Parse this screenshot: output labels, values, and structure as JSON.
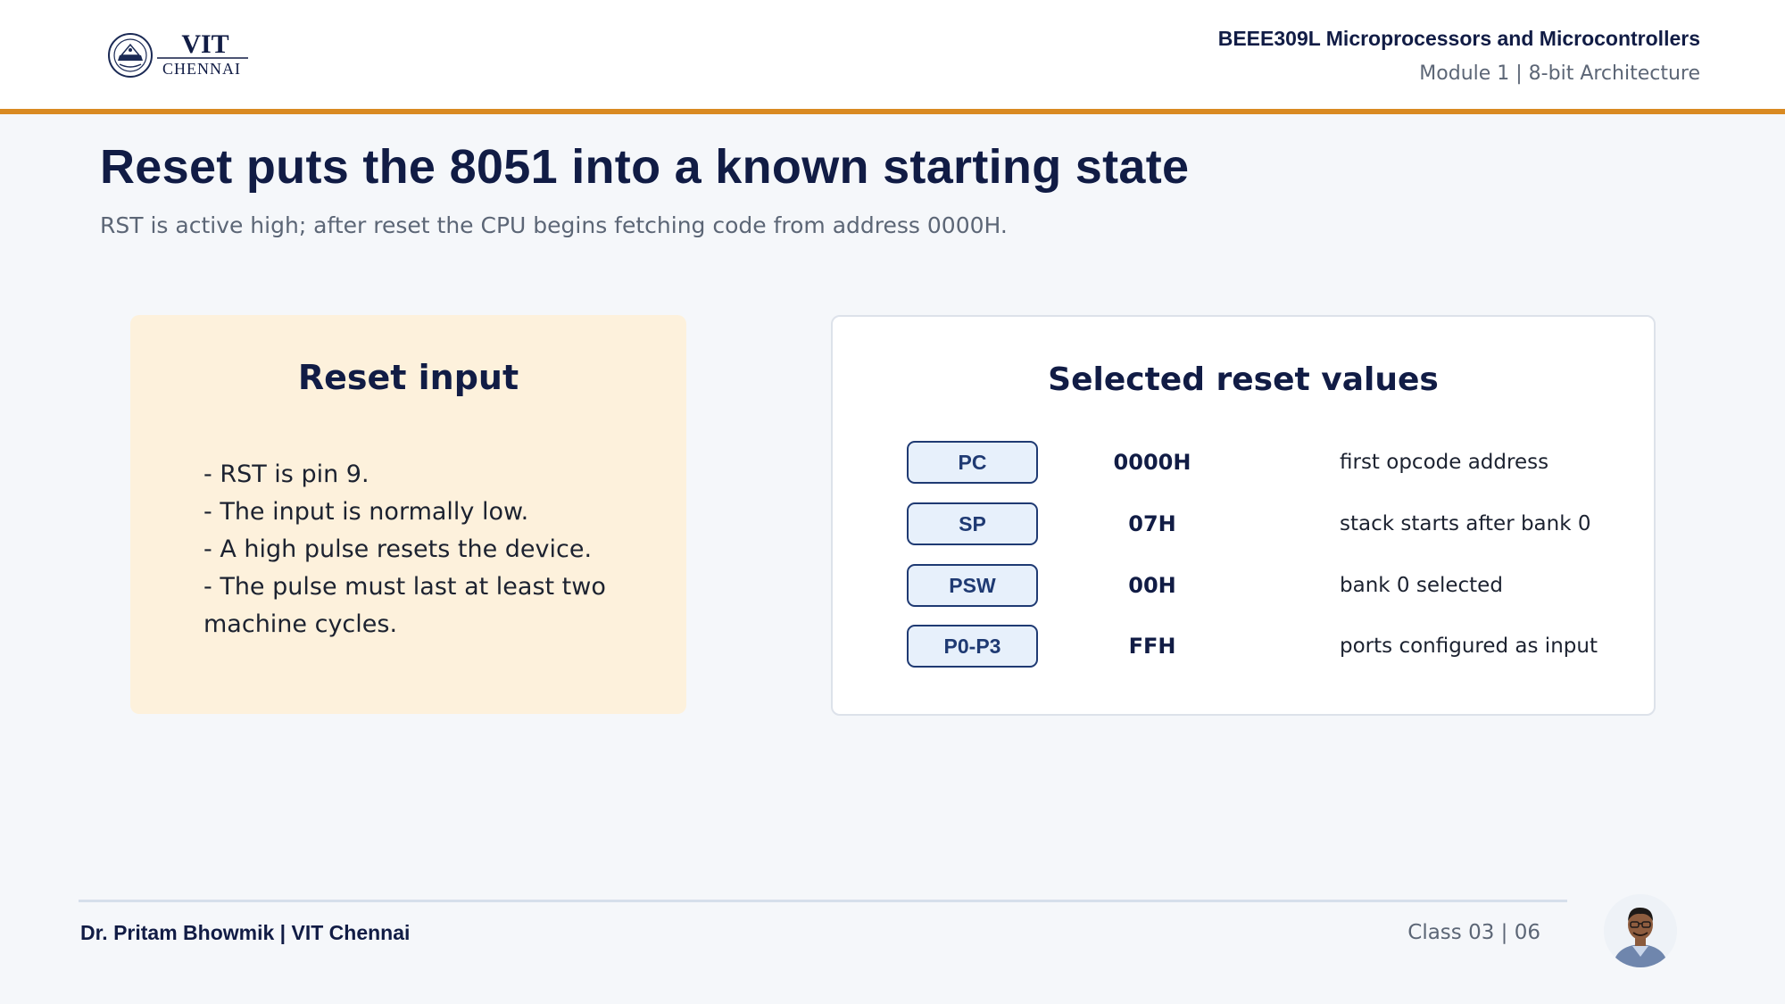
{
  "header": {
    "logo": {
      "name": "VIT",
      "campus": "CHENNAI"
    },
    "course_title": "BEEE309L Microprocessors and Microcontrollers",
    "module": "Module 1 | 8-bit Architecture",
    "accent_color": "#d98a22"
  },
  "slide": {
    "title": "Reset puts the 8051 into a known starting state",
    "subtitle": "RST is active high; after reset the CPU begins fetching code from address 0000H."
  },
  "reset_input": {
    "title": "Reset input",
    "bullets": [
      "- RST is pin 9.",
      "- The input is normally low.",
      "- A high pulse resets the device.",
      "- The pulse must last at least two machine cycles."
    ]
  },
  "reset_values": {
    "title": "Selected reset values",
    "rows": [
      {
        "register": "PC",
        "value": "0000H",
        "description": "first opcode address"
      },
      {
        "register": "SP",
        "value": "07H",
        "description": "stack starts after bank 0"
      },
      {
        "register": "PSW",
        "value": "00H",
        "description": "bank 0 selected"
      },
      {
        "register": "P0-P3",
        "value": "FFH",
        "description": "ports configured as input"
      }
    ]
  },
  "footer": {
    "presenter": "Dr. Pritam Bhowmik | VIT Chennai",
    "class_info": "Class 03  |  06",
    "avatar_icon": "presenter-photo"
  }
}
